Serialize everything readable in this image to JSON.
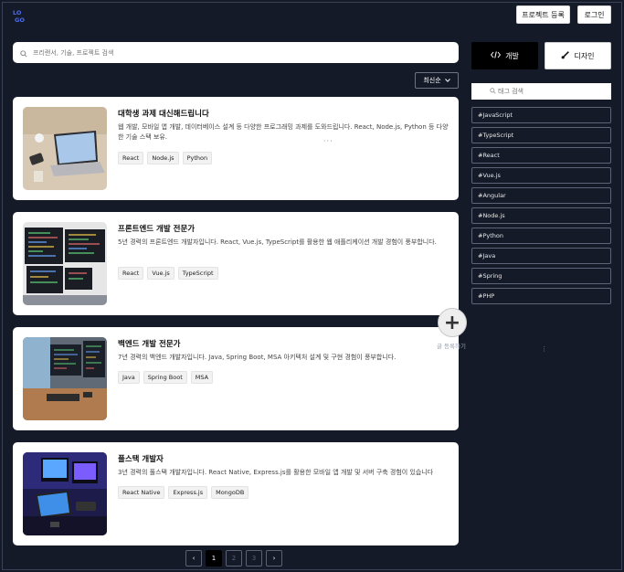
{
  "header": {
    "logo_text": "LOGO",
    "register_label": "프로젝트 등록",
    "login_label": "로그인"
  },
  "search": {
    "placeholder": "프리랜서, 기술, 프로젝트 검색"
  },
  "sort": {
    "label": "최신순"
  },
  "cards": [
    {
      "title": "대학생 과제 대신해드립니다",
      "description": "웹 개발, 모바일 앱 개발, 데이터베이스 설계 등 다양한 프로그래밍 과제를 도와드립니다. React, Node.js, Python 등 다양한 기술 스택 보유.",
      "tags": [
        "React",
        "Node.js",
        "Python"
      ]
    },
    {
      "title": "프론트엔드 개발 전문가",
      "description": "5년 경력의 프론트엔드 개발자입니다. React, Vue.js, TypeScript를 활용한 웹 애플리케이션 개발 경험이 풍부합니다.",
      "tags": [
        "React",
        "Vue.js",
        "TypeScript"
      ]
    },
    {
      "title": "백엔드 개발 전문가",
      "description": "7년 경력의 백엔드 개발자입니다. Java, Spring Boot, MSA 아키텍처 설계 및 구현 경험이 풍부합니다.",
      "tags": [
        "Java",
        "Spring Boot",
        "MSA"
      ]
    },
    {
      "title": "풀스택 개발자",
      "description": "3년 경력의 풀스택 개발자입니다. React Native, Express.js를 활용한 모바일 앱 개발 및 서버 구축 경험이 있습니다",
      "tags": [
        "React Native",
        "Express.js",
        "MongoDB"
      ]
    }
  ],
  "pagination": {
    "prev": "‹",
    "pages": [
      "1",
      "2",
      "3"
    ],
    "next": "›",
    "current": "1"
  },
  "sidebar": {
    "tabs": [
      {
        "label": "개발",
        "icon": "code-icon"
      },
      {
        "label": "디자인",
        "icon": "brush-icon"
      }
    ],
    "tag_search_placeholder": "태그 검색",
    "tags": [
      "#JavaScript",
      "#TypeScript",
      "#React",
      "#Vue.js",
      "#Angular",
      "#Node.js",
      "#Python",
      "#Java",
      "#Spring",
      "#PHP"
    ]
  },
  "fab": {
    "symbol": "+",
    "label": "글 등록하기"
  },
  "colors": {
    "background": "#141a28",
    "active_tab": "#000000",
    "card": "#ffffff"
  }
}
